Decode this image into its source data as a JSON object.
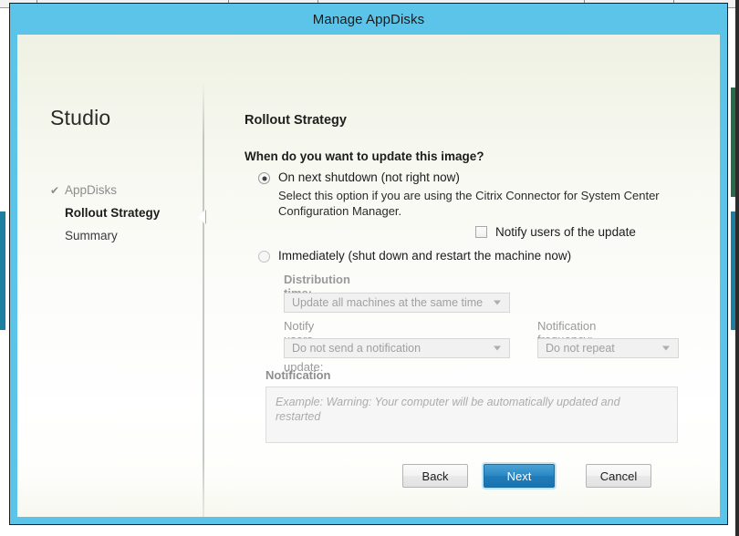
{
  "desktop": {
    "note": ""
  },
  "window": {
    "title": "Manage AppDisks"
  },
  "sidebar": {
    "product": "Studio",
    "items": [
      {
        "label": "AppDisks",
        "state": "done",
        "icon": "check-icon"
      },
      {
        "label": "Rollout Strategy",
        "state": "current"
      },
      {
        "label": "Summary",
        "state": "future"
      }
    ]
  },
  "content": {
    "page_title": "Rollout Strategy",
    "question": "When do you want to update this image?",
    "options": {
      "shutdown": {
        "label": "On next shutdown (not right now)",
        "description": "Select this option if you are using the Citrix Connector for System Center Configuration Manager.",
        "selected": true
      },
      "notify_checkbox": {
        "label": "Notify users of the update",
        "checked": false
      },
      "immediate": {
        "label": "Immediately (shut down and restart the machine now)",
        "selected": false
      }
    },
    "fields": {
      "distribution_time": {
        "label": "Distribution time:",
        "value": "Update all machines at the same time",
        "enabled": false
      },
      "notify_users": {
        "label": "Notify users of the update:",
        "value": "Do not send a notification",
        "enabled": false
      },
      "notification_frequency": {
        "label": "Notification frequency:",
        "value": "Do not repeat",
        "enabled": false
      },
      "notification_message": {
        "label": "Notification message",
        "placeholder": "Example:  Warning: Your computer will be automatically updated and restarted",
        "value": "",
        "enabled": false
      }
    }
  },
  "footer": {
    "back": "Back",
    "next": "Next",
    "cancel": "Cancel"
  },
  "colors": {
    "titlebar": "#5bc4e8",
    "primary_button": "#2b89c6",
    "disabled_text": "#a0a0a0"
  }
}
